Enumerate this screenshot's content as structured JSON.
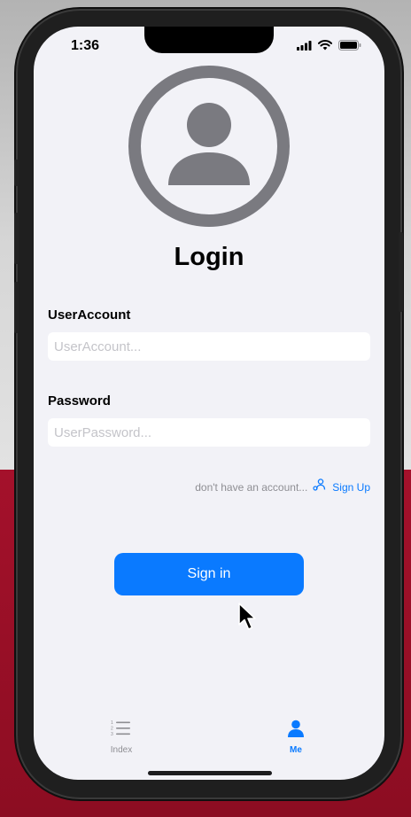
{
  "status_bar": {
    "time": "1:36"
  },
  "login": {
    "title": "Login"
  },
  "account": {
    "label": "UserAccount",
    "placeholder": "UserAccount...",
    "value": ""
  },
  "password": {
    "label": "Password",
    "placeholder": "UserPassword...",
    "value": ""
  },
  "signup": {
    "hint": "don't have an account...",
    "link_label": "Sign Up"
  },
  "signin": {
    "label": "Sign in"
  },
  "tab_bar": {
    "items": [
      {
        "label": "Index",
        "icon": "list-icon",
        "active": false
      },
      {
        "label": "Me",
        "icon": "person-icon",
        "active": true
      }
    ]
  },
  "colors": {
    "accent": "#0A7AFF",
    "background": "#F2F2F7",
    "avatar": "#7A7A80",
    "hint": "#8E8E93"
  }
}
